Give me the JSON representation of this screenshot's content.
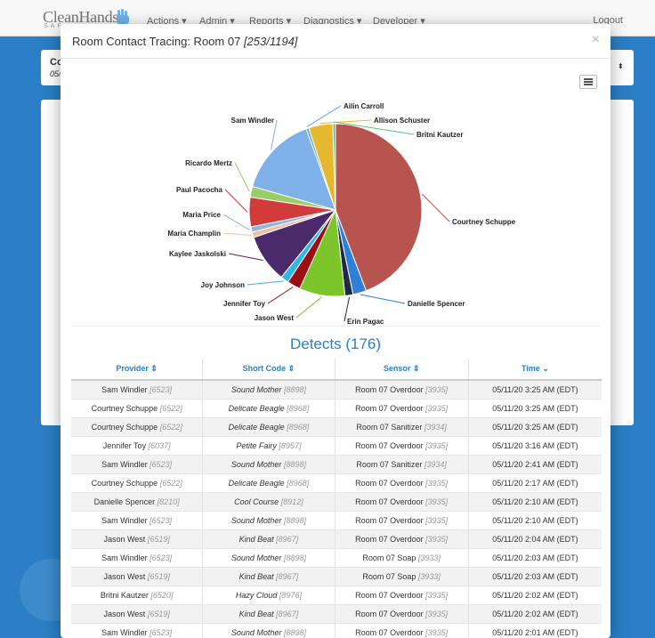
{
  "navbar": {
    "brand": "CleanHands",
    "brand_sub": "SAF",
    "items": [
      "Actions",
      "Admin",
      "Reports",
      "Diagnostics",
      "Developer"
    ],
    "logout": "Logout"
  },
  "background": {
    "card_title": "Co",
    "card_sub": "05/",
    "caret": "▲▼"
  },
  "modal": {
    "title": "Room Contact Tracing: Room 07",
    "title_count": "[253/1194]",
    "close": "×"
  },
  "chart_data": {
    "type": "pie",
    "slices": [
      {
        "label": "Courtney Schuppe",
        "value": 44,
        "color": "#b85450"
      },
      {
        "label": "Danielle Spencer",
        "value": 2.5,
        "color": "#2f7ed8"
      },
      {
        "label": "Erin Pagac",
        "value": 1.5,
        "color": "#1d2b47"
      },
      {
        "label": "Jason West",
        "value": 8.5,
        "color": "#7cc52a"
      },
      {
        "label": "Jennifer Toy",
        "value": 2.5,
        "color": "#9b0f10"
      },
      {
        "label": "Joy Johnson",
        "value": 1.5,
        "color": "#33b5e5"
      },
      {
        "label": "Kaylee Jaskolski",
        "value": 9,
        "color": "#4a2a6b"
      },
      {
        "label": "Maria Champlin",
        "value": 1,
        "color": "#f2c0a0"
      },
      {
        "label": "Maria Price",
        "value": 1,
        "color": "#8fb3e0"
      },
      {
        "label": "Paul Pacocha",
        "value": 5.5,
        "color": "#d13b3b"
      },
      {
        "label": "Ricardo Mertz",
        "value": 2,
        "color": "#9acd6a"
      },
      {
        "label": "Sam Windler",
        "value": 15,
        "color": "#7fb1e8"
      },
      {
        "label": "Ailin Carroll",
        "value": 0.5,
        "color": "#5fa9e8"
      },
      {
        "label": "Allison Schuster",
        "value": 4.5,
        "color": "#e6b830"
      },
      {
        "label": "Britni Kautzer",
        "value": 0.5,
        "color": "#5ec27a"
      }
    ]
  },
  "detects": {
    "title": "Detects (176)",
    "headers": [
      "Provider ⇕",
      "Short Code ⇕",
      "Sensor ⇕",
      "Time ⌄"
    ],
    "rows": [
      [
        "Sam Windler",
        "[6523]",
        "Sound Mother",
        "[8898]",
        "Room 07 Overdoor",
        "[3935]",
        "05/11/20 3:25 AM (EDT)"
      ],
      [
        "Courtney Schuppe",
        "[6522]",
        "Delicate Beagle",
        "[8968]",
        "Room 07 Overdoor",
        "[3935]",
        "05/11/20 3:25 AM (EDT)"
      ],
      [
        "Courtney Schuppe",
        "[6522]",
        "Delicate Beagle",
        "[8968]",
        "Room 07 Sanitizer",
        "[3934]",
        "05/11/20 3:25 AM (EDT)"
      ],
      [
        "Jennifer Toy",
        "[6037]",
        "Petite Fairy",
        "[8957]",
        "Room 07 Overdoor",
        "[3935]",
        "05/11/20 3:16 AM (EDT)"
      ],
      [
        "Sam Windler",
        "[6523]",
        "Sound Mother",
        "[8898]",
        "Room 07 Sanitizer",
        "[3934]",
        "05/11/20 2:41 AM (EDT)"
      ],
      [
        "Courtney Schuppe",
        "[6522]",
        "Delicate Beagle",
        "[8968]",
        "Room 07 Overdoor",
        "[3935]",
        "05/11/20 2:17 AM (EDT)"
      ],
      [
        "Danielle Spencer",
        "[8210]",
        "Cool Course",
        "[8912]",
        "Room 07 Overdoor",
        "[3935]",
        "05/11/20 2:10 AM (EDT)"
      ],
      [
        "Sam Windler",
        "[6523]",
        "Sound Mother",
        "[8898]",
        "Room 07 Overdoor",
        "[3935]",
        "05/11/20 2:10 AM (EDT)"
      ],
      [
        "Jason West",
        "[6519]",
        "Kind Beat",
        "[8967]",
        "Room 07 Overdoor",
        "[3935]",
        "05/11/20 2:04 AM (EDT)"
      ],
      [
        "Sam Windler",
        "[6523]",
        "Sound Mother",
        "[8898]",
        "Room 07 Soap",
        "[3933]",
        "05/11/20 2:03 AM (EDT)"
      ],
      [
        "Jason West",
        "[6519]",
        "Kind Beat",
        "[8967]",
        "Room 07 Soap",
        "[3933]",
        "05/11/20 2:03 AM (EDT)"
      ],
      [
        "Britni Kautzer",
        "[6520]",
        "Hazy Cloud",
        "[8976]",
        "Room 07 Overdoor",
        "[3935]",
        "05/11/20 2:02 AM (EDT)"
      ],
      [
        "Jason West",
        "[6519]",
        "Kind Beat",
        "[8967]",
        "Room 07 Overdoor",
        "[3935]",
        "05/11/20 2:02 AM (EDT)"
      ],
      [
        "Sam Windler",
        "[6523]",
        "Sound Mother",
        "[8898]",
        "Room 07 Overdoor",
        "[3935]",
        "05/11/20 2:01 AM (EDT)"
      ]
    ]
  }
}
